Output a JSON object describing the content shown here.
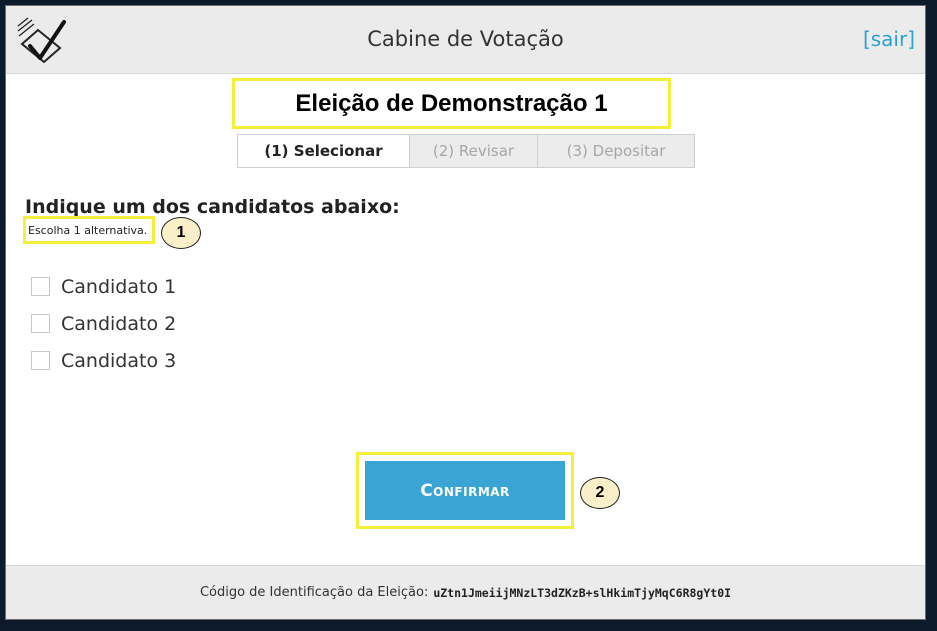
{
  "header": {
    "title": "Cabine de Votação",
    "exit_label": "[sair]",
    "logo_icon": "ballot-check-icon"
  },
  "election": {
    "title": "Eleição de Demonstração 1"
  },
  "steps": [
    {
      "label": "(1) Selecionar",
      "active": true
    },
    {
      "label": "(2) Revisar",
      "active": false
    },
    {
      "label": "(3) Depositar",
      "active": false
    }
  ],
  "question": {
    "prompt": "Indique um dos candidatos abaixo:",
    "hint": "Escolha 1 alternativa."
  },
  "candidates": [
    {
      "label": "Candidato 1",
      "checked": false
    },
    {
      "label": "Candidato 2",
      "checked": false
    },
    {
      "label": "Candidato 3",
      "checked": false
    }
  ],
  "actions": {
    "confirm_label": "Confirmar"
  },
  "callouts": {
    "first": "1",
    "second": "2"
  },
  "footer": {
    "label": "Código de Identificação da Eleição:",
    "code": "uZtn1JmeiijMNzLT3dZKzB+slHkimTjyMqC6R8gYt0I"
  },
  "colors": {
    "accent": "#3aa4d4",
    "link": "#2aa3cf",
    "highlight": "#f4ef3b",
    "callout_fill": "#fbefc9"
  }
}
